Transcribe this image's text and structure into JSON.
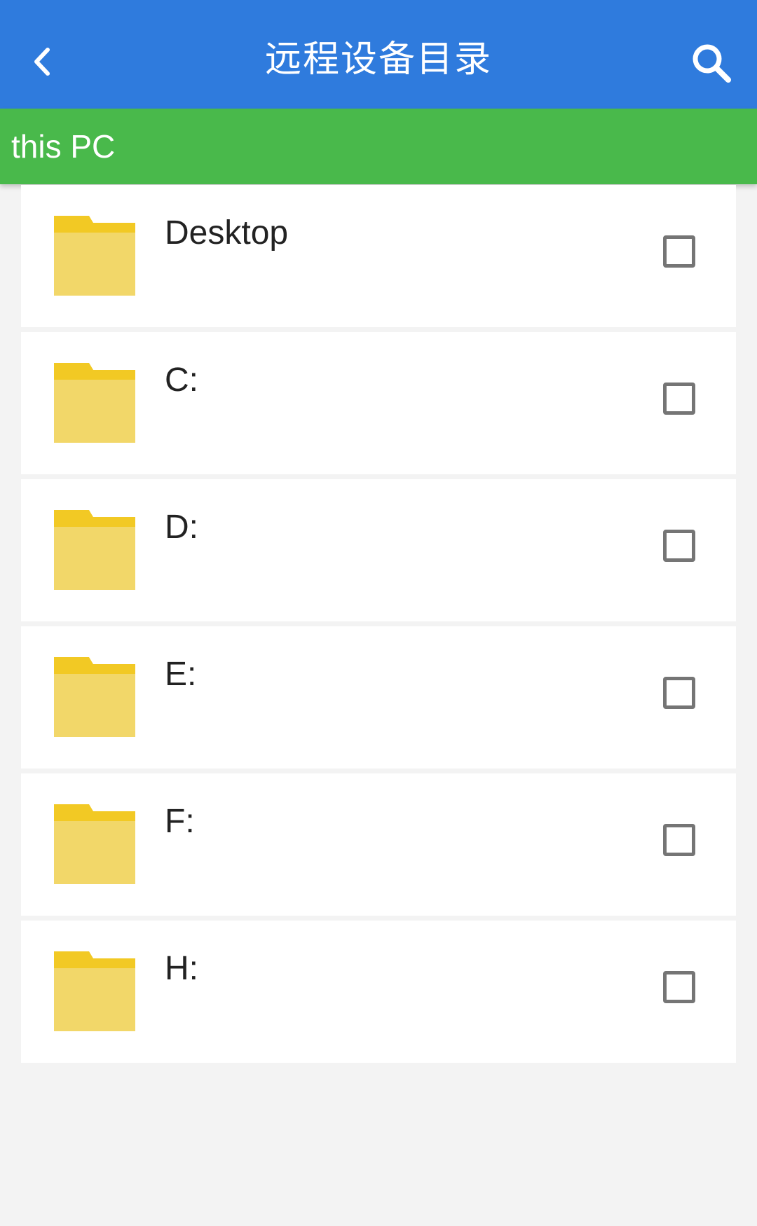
{
  "header": {
    "title": "远程设备目录",
    "back_icon": "chevron-left-icon",
    "search_icon": "search-icon",
    "background": "#2f7bdd"
  },
  "path_bar": {
    "label": "this PC",
    "background": "#49b94b"
  },
  "items": [
    {
      "label": "Desktop",
      "icon": "folder-icon",
      "checked": false
    },
    {
      "label": "C:",
      "icon": "folder-icon",
      "checked": false
    },
    {
      "label": "D:",
      "icon": "folder-icon",
      "checked": false
    },
    {
      "label": "E:",
      "icon": "folder-icon",
      "checked": false
    },
    {
      "label": "F:",
      "icon": "folder-icon",
      "checked": false
    },
    {
      "label": "H:",
      "icon": "folder-icon",
      "checked": false
    }
  ]
}
